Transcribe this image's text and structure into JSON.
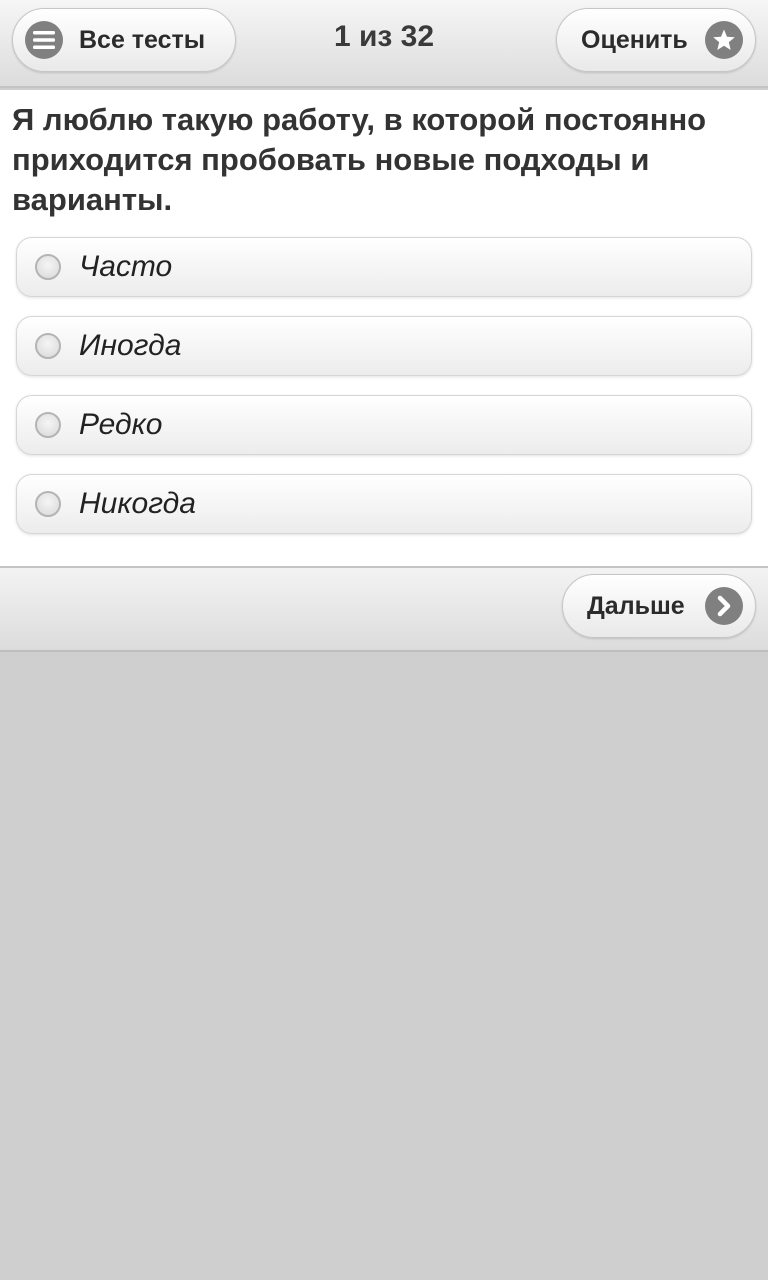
{
  "header": {
    "all_tests_label": "Все тесты",
    "counter": "1 из 32",
    "rate_label": "Оценить"
  },
  "question": {
    "text": "Я люблю такую работу, в которой постоянно приходится пробовать новые подходы и варианты.",
    "options": [
      {
        "label": "Часто"
      },
      {
        "label": "Иногда"
      },
      {
        "label": "Редко"
      },
      {
        "label": "Никогда"
      }
    ]
  },
  "footer": {
    "next_label": "Дальше"
  },
  "icons": {
    "menu": "menu-icon",
    "rate": "star-icon",
    "next": "chevron-right-icon"
  },
  "colors": {
    "icon_circle": "#808080",
    "background": "#cfcfcf"
  }
}
